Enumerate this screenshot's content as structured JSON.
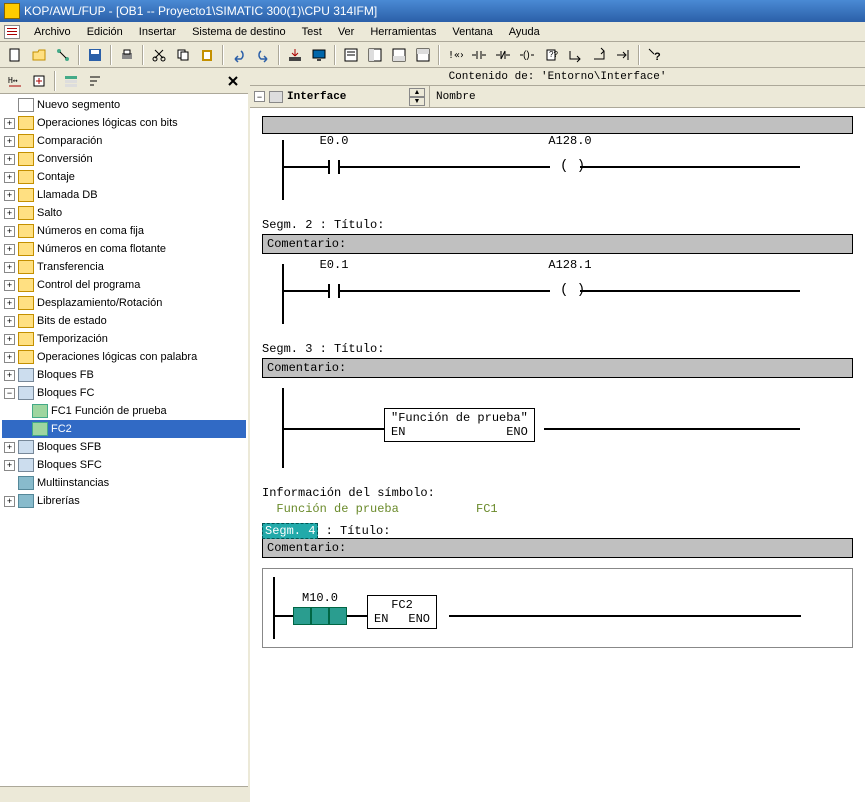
{
  "window": {
    "title": "KOP/AWL/FUP  - [OB1  -- Proyecto1\\SIMATIC 300(1)\\CPU 314IFM]"
  },
  "menu": {
    "items": [
      "Archivo",
      "Edición",
      "Insertar",
      "Sistema de destino",
      "Test",
      "Ver",
      "Herramientas",
      "Ventana",
      "Ayuda"
    ]
  },
  "content_header": "Contenido de: 'Entorno\\Interface'",
  "interface": {
    "label": "Interface",
    "name_col": "Nombre"
  },
  "tree": {
    "items": [
      {
        "indent": 0,
        "toggle": "",
        "icon": "new",
        "label": "Nuevo segmento"
      },
      {
        "indent": 0,
        "toggle": "+",
        "icon": "folder",
        "label": "Operaciones lógicas con bits"
      },
      {
        "indent": 0,
        "toggle": "+",
        "icon": "folder",
        "label": "Comparación"
      },
      {
        "indent": 0,
        "toggle": "+",
        "icon": "folder",
        "label": "Conversión"
      },
      {
        "indent": 0,
        "toggle": "+",
        "icon": "folder",
        "label": "Contaje"
      },
      {
        "indent": 0,
        "toggle": "+",
        "icon": "folder",
        "label": "Llamada DB"
      },
      {
        "indent": 0,
        "toggle": "+",
        "icon": "folder",
        "label": "Salto"
      },
      {
        "indent": 0,
        "toggle": "+",
        "icon": "folder",
        "label": "Números en coma fija"
      },
      {
        "indent": 0,
        "toggle": "+",
        "icon": "folder",
        "label": "Números en coma flotante"
      },
      {
        "indent": 0,
        "toggle": "+",
        "icon": "folder",
        "label": "Transferencia"
      },
      {
        "indent": 0,
        "toggle": "+",
        "icon": "folder",
        "label": "Control del programa"
      },
      {
        "indent": 0,
        "toggle": "+",
        "icon": "folder",
        "label": "Desplazamiento/Rotación"
      },
      {
        "indent": 0,
        "toggle": "+",
        "icon": "folder",
        "label": "Bits de estado"
      },
      {
        "indent": 0,
        "toggle": "+",
        "icon": "folder",
        "label": "Temporización"
      },
      {
        "indent": 0,
        "toggle": "+",
        "icon": "folder",
        "label": "Operaciones lógicas con palabra"
      },
      {
        "indent": 0,
        "toggle": "+",
        "icon": "fb",
        "label": "Bloques FB"
      },
      {
        "indent": 0,
        "toggle": "-",
        "icon": "fb",
        "label": "Bloques FC"
      },
      {
        "indent": 1,
        "toggle": "",
        "icon": "fc",
        "label": "FC1   Función de prueba"
      },
      {
        "indent": 1,
        "toggle": "",
        "icon": "fc",
        "label": "FC2",
        "selected": true
      },
      {
        "indent": 0,
        "toggle": "+",
        "icon": "fb",
        "label": "Bloques SFB"
      },
      {
        "indent": 0,
        "toggle": "+",
        "icon": "fb",
        "label": "Bloques SFC"
      },
      {
        "indent": 0,
        "toggle": "",
        "icon": "lib",
        "label": "Multiinstancias"
      },
      {
        "indent": 0,
        "toggle": "+",
        "icon": "lib",
        "label": "Librerías"
      }
    ]
  },
  "ladder": {
    "seg1": {
      "input": "E0.0",
      "output": "A128.0"
    },
    "seg2": {
      "title": "Segm. 2 : Título:",
      "comment_label": "Comentario:",
      "input": "E0.1",
      "output": "A128.1"
    },
    "seg3": {
      "title": "Segm. 3 : Título:",
      "comment_label": "Comentario:",
      "block_title": "\"Función de prueba\"",
      "en": "EN",
      "eno": "ENO"
    },
    "syminfo": {
      "header": "Información del símbolo:",
      "name": "Función de prueba",
      "fc": "FC1"
    },
    "seg4": {
      "title_pre": "Segm. 4",
      "title_post": " : Título:",
      "comment_label": "Comentario:",
      "mem": "M10.0",
      "block": "FC2",
      "en": "EN",
      "eno": "ENO"
    }
  }
}
